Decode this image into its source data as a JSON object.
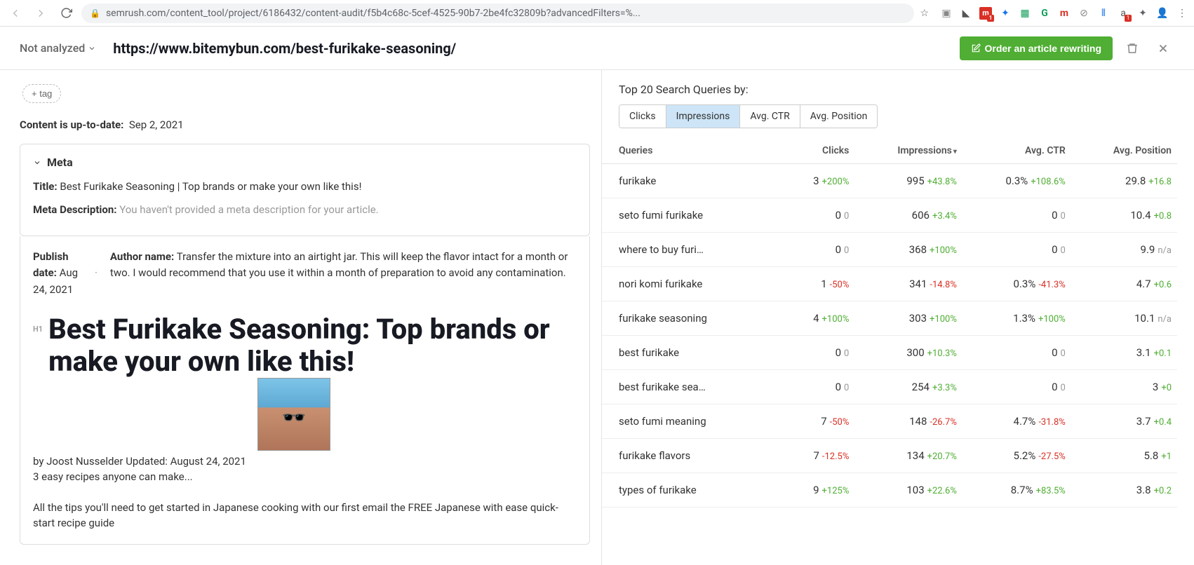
{
  "browser": {
    "url_display": "semrush.com/content_tool/project/6186432/content-audit/f5b4c68c-5cef-4525-90b7-2be4fc32809b?advancedFilters=%..."
  },
  "header": {
    "status_label": "Not analyzed",
    "page_url": "https://www.bitemybun.com/best-furikake-seasoning/",
    "order_button": "Order an article rewriting"
  },
  "left": {
    "add_tag": "+ tag",
    "content_date_label": "Content is up-to-date:",
    "content_date_value": "Sep 2, 2021",
    "meta": {
      "section": "Meta",
      "title_label": "Title:",
      "title_value": "Best Furikake Seasoning | Top brands or make your own like this!",
      "desc_label": "Meta Description:",
      "desc_value": "You haven't provided a meta description for your article."
    },
    "publish": {
      "date_label": "Publish date:",
      "date_value": "Aug 24, 2021",
      "author_label": "Author name:",
      "author_value": "Transfer the mixture into an airtight jar. This will keep the flavor intact for a month or two. I would recommend that you use it within a month of preparation to avoid any contamination."
    },
    "h1_badge": "H1",
    "h1_text": "Best Furikake Seasoning: Top brands or make your own like this!",
    "byline": "by Joost Nusselder Updated:  August 24, 2021",
    "intro": "3 easy recipes anyone can make...",
    "body": "All the tips you'll need to get started in Japanese cooking with our first email the FREE Japanese with ease quick-start recipe guide"
  },
  "right": {
    "title": "Top 20 Search Queries by:",
    "tabs": [
      "Clicks",
      "Impressions",
      "Avg. CTR",
      "Avg. Position"
    ],
    "active_tab": 1,
    "columns": [
      "Queries",
      "Clicks",
      "Impressions",
      "Avg. CTR",
      "Avg. Position"
    ],
    "rows": [
      {
        "q": "furikake",
        "clicks": "3",
        "clicks_d": "+200%",
        "clicks_dc": "pos",
        "imp": "995",
        "imp_d": "+43.8%",
        "imp_dc": "pos",
        "ctr": "0.3%",
        "ctr_d": "+108.6%",
        "ctr_dc": "pos",
        "pos": "29.8",
        "pos_d": "+16.8",
        "pos_dc": "pos"
      },
      {
        "q": "seto fumi furikake",
        "clicks": "0",
        "clicks_d": "0",
        "clicks_dc": "muted",
        "imp": "606",
        "imp_d": "+3.4%",
        "imp_dc": "pos",
        "ctr": "0",
        "ctr_d": "0",
        "ctr_dc": "muted",
        "pos": "10.4",
        "pos_d": "+0.8",
        "pos_dc": "pos"
      },
      {
        "q": "where to buy furi…",
        "clicks": "0",
        "clicks_d": "0",
        "clicks_dc": "muted",
        "imp": "368",
        "imp_d": "+100%",
        "imp_dc": "pos",
        "ctr": "0",
        "ctr_d": "0",
        "ctr_dc": "muted",
        "pos": "9.9",
        "pos_d": "n/a",
        "pos_dc": "muted"
      },
      {
        "q": "nori komi furikake",
        "clicks": "1",
        "clicks_d": "-50%",
        "clicks_dc": "neg",
        "imp": "341",
        "imp_d": "-14.8%",
        "imp_dc": "neg",
        "ctr": "0.3%",
        "ctr_d": "-41.3%",
        "ctr_dc": "neg",
        "pos": "4.7",
        "pos_d": "+0.6",
        "pos_dc": "pos"
      },
      {
        "q": "furikake seasoning",
        "clicks": "4",
        "clicks_d": "+100%",
        "clicks_dc": "pos",
        "imp": "303",
        "imp_d": "+100%",
        "imp_dc": "pos",
        "ctr": "1.3%",
        "ctr_d": "+100%",
        "ctr_dc": "pos",
        "pos": "10.1",
        "pos_d": "n/a",
        "pos_dc": "muted"
      },
      {
        "q": "best furikake",
        "clicks": "0",
        "clicks_d": "0",
        "clicks_dc": "muted",
        "imp": "300",
        "imp_d": "+10.3%",
        "imp_dc": "pos",
        "ctr": "0",
        "ctr_d": "0",
        "ctr_dc": "muted",
        "pos": "3.1",
        "pos_d": "+0.1",
        "pos_dc": "pos"
      },
      {
        "q": "best furikake sea…",
        "clicks": "0",
        "clicks_d": "0",
        "clicks_dc": "muted",
        "imp": "254",
        "imp_d": "+3.3%",
        "imp_dc": "pos",
        "ctr": "0",
        "ctr_d": "0",
        "ctr_dc": "muted",
        "pos": "3",
        "pos_d": "+0",
        "pos_dc": "pos"
      },
      {
        "q": "seto fumi meaning",
        "clicks": "7",
        "clicks_d": "-50%",
        "clicks_dc": "neg",
        "imp": "148",
        "imp_d": "-26.7%",
        "imp_dc": "neg",
        "ctr": "4.7%",
        "ctr_d": "-31.8%",
        "ctr_dc": "neg",
        "pos": "3.7",
        "pos_d": "+0.4",
        "pos_dc": "pos"
      },
      {
        "q": "furikake flavors",
        "clicks": "7",
        "clicks_d": "-12.5%",
        "clicks_dc": "neg",
        "imp": "134",
        "imp_d": "+20.7%",
        "imp_dc": "pos",
        "ctr": "5.2%",
        "ctr_d": "-27.5%",
        "ctr_dc": "neg",
        "pos": "5.8",
        "pos_d": "+1",
        "pos_dc": "pos"
      },
      {
        "q": "types of furikake",
        "clicks": "9",
        "clicks_d": "+125%",
        "clicks_dc": "pos",
        "imp": "103",
        "imp_d": "+22.6%",
        "imp_dc": "pos",
        "ctr": "8.7%",
        "ctr_d": "+83.5%",
        "ctr_dc": "pos",
        "pos": "3.8",
        "pos_d": "+0.2",
        "pos_dc": "pos"
      }
    ]
  }
}
